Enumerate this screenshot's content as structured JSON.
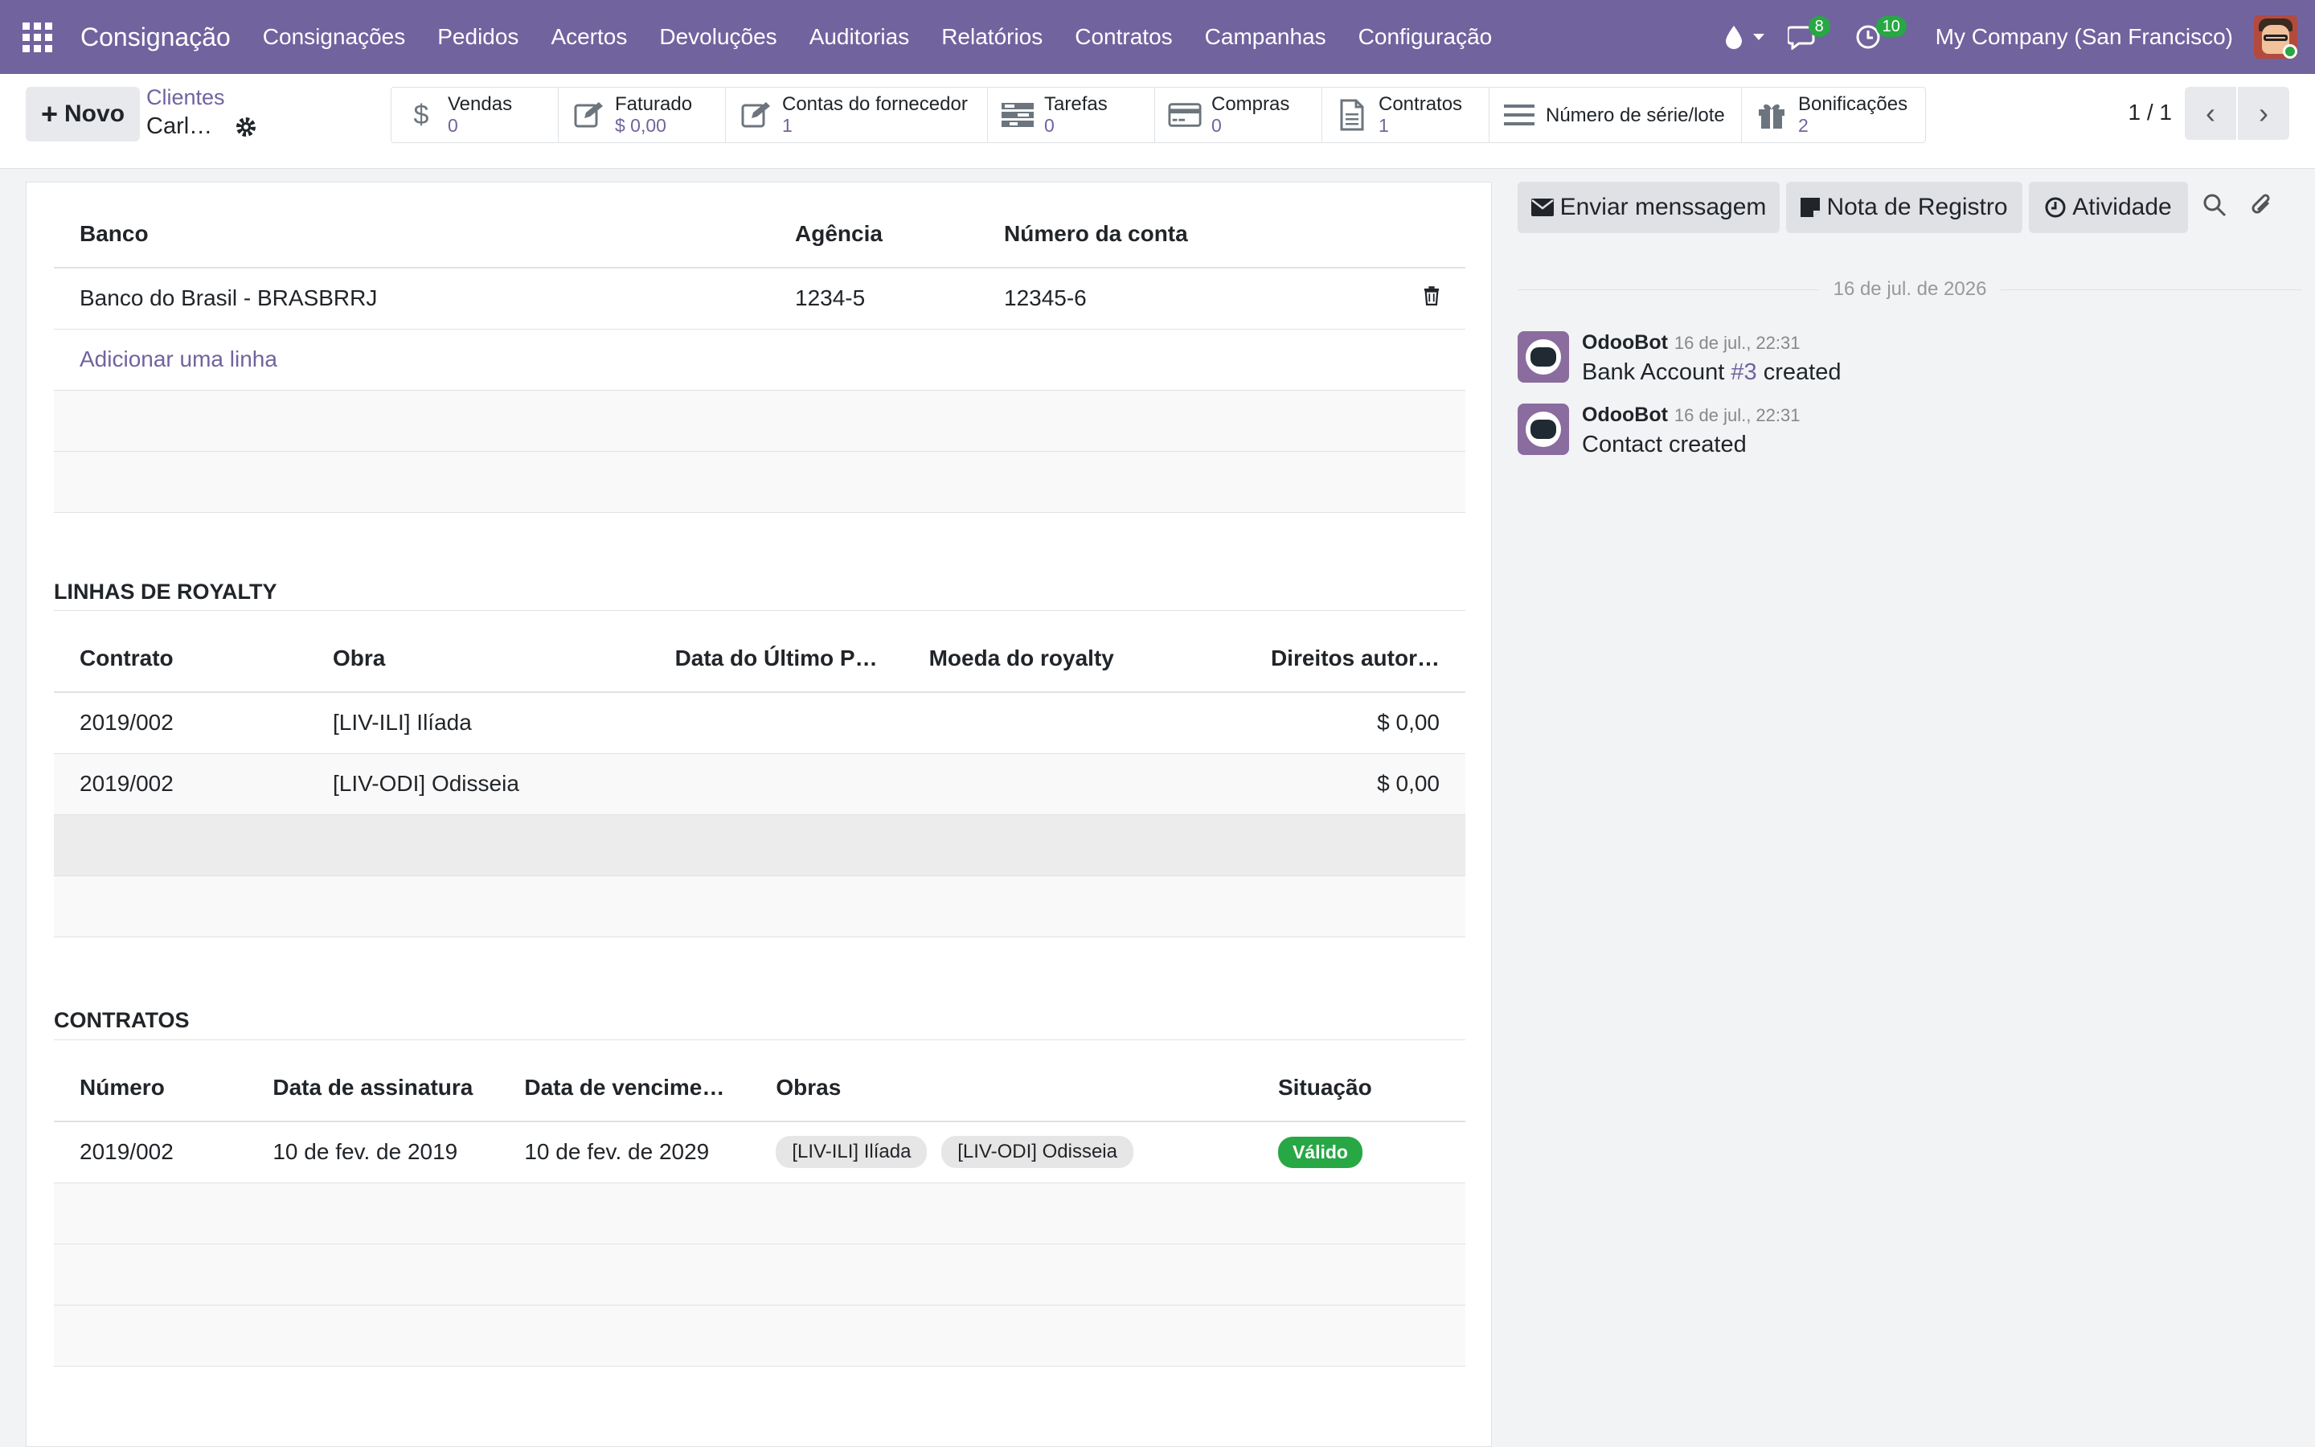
{
  "navbar": {
    "brand": "Consignação",
    "menu": [
      "Consignações",
      "Pedidos",
      "Acertos",
      "Devoluções",
      "Auditorias",
      "Relatórios",
      "Contratos",
      "Campanhas",
      "Configuração"
    ],
    "messages_count": "8",
    "activities_count": "10",
    "company": "My Company (San Francisco)"
  },
  "control_panel": {
    "new_label": "Novo",
    "breadcrumb_parent": "Clientes",
    "breadcrumb_current": "Carl…",
    "smart_buttons": [
      {
        "icon": "dollar-icon",
        "label": "Vendas",
        "value": "0"
      },
      {
        "icon": "edit-icon",
        "label": "Faturado",
        "value": "$ 0,00"
      },
      {
        "icon": "edit-icon",
        "label": "Contas do fornecedor",
        "value": "1"
      },
      {
        "icon": "tasks-icon",
        "label": "Tarefas",
        "value": "0"
      },
      {
        "icon": "credit-card-icon",
        "label": "Compras",
        "value": "0"
      },
      {
        "icon": "file-icon",
        "label": "Contratos",
        "value": "1"
      },
      {
        "icon": "list-icon",
        "label": "Número de série/lote",
        "value": ""
      },
      {
        "icon": "gift-icon",
        "label": "Bonificações",
        "value": "2"
      }
    ],
    "pager": "1 / 1"
  },
  "bank_table": {
    "headers": [
      "Banco",
      "Agência",
      "Número da conta"
    ],
    "rows": [
      [
        "Banco do Brasil - BRASBRRJ",
        "1234-5",
        "12345-6"
      ]
    ],
    "add_line": "Adicionar uma linha"
  },
  "royalty": {
    "title": "LINHAS DE ROYALTY",
    "headers": [
      "Contrato",
      "Obra",
      "Data do Último P…",
      "Moeda do royalty",
      "Direitos autor…"
    ],
    "rows": [
      [
        "2019/002",
        "[LIV-ILI] Ilíada",
        "",
        "",
        "$ 0,00"
      ],
      [
        "2019/002",
        "[LIV-ODI] Odisseia",
        "",
        "",
        "$ 0,00"
      ]
    ]
  },
  "contracts": {
    "title": "CONTRATOS",
    "headers": [
      "Número",
      "Data de assinatura",
      "Data de vencime…",
      "Obras",
      "Situação"
    ],
    "rows": [
      {
        "numero": "2019/002",
        "assinatura": "10 de fev. de 2019",
        "vencimento": "10 de fev. de 2029",
        "obras": [
          "[LIV-ILI] Ilíada",
          "[LIV-ODI] Odisseia"
        ],
        "situacao": "Válido"
      }
    ]
  },
  "chatter": {
    "send_message": "Enviar menssagem",
    "log_note": "Nota de Registro",
    "activity": "Atividade",
    "date_separator": "16 de jul. de 2026",
    "messages": [
      {
        "author": "OdooBot",
        "date": "16 de jul., 22:31",
        "body_prefix": "Bank Account ",
        "body_link": "#3",
        "body_suffix": " created"
      },
      {
        "author": "OdooBot",
        "date": "16 de jul., 22:31",
        "body_prefix": "Contact created",
        "body_link": "",
        "body_suffix": ""
      }
    ]
  },
  "colors": {
    "brand": "#71639e",
    "success": "#28a745"
  }
}
